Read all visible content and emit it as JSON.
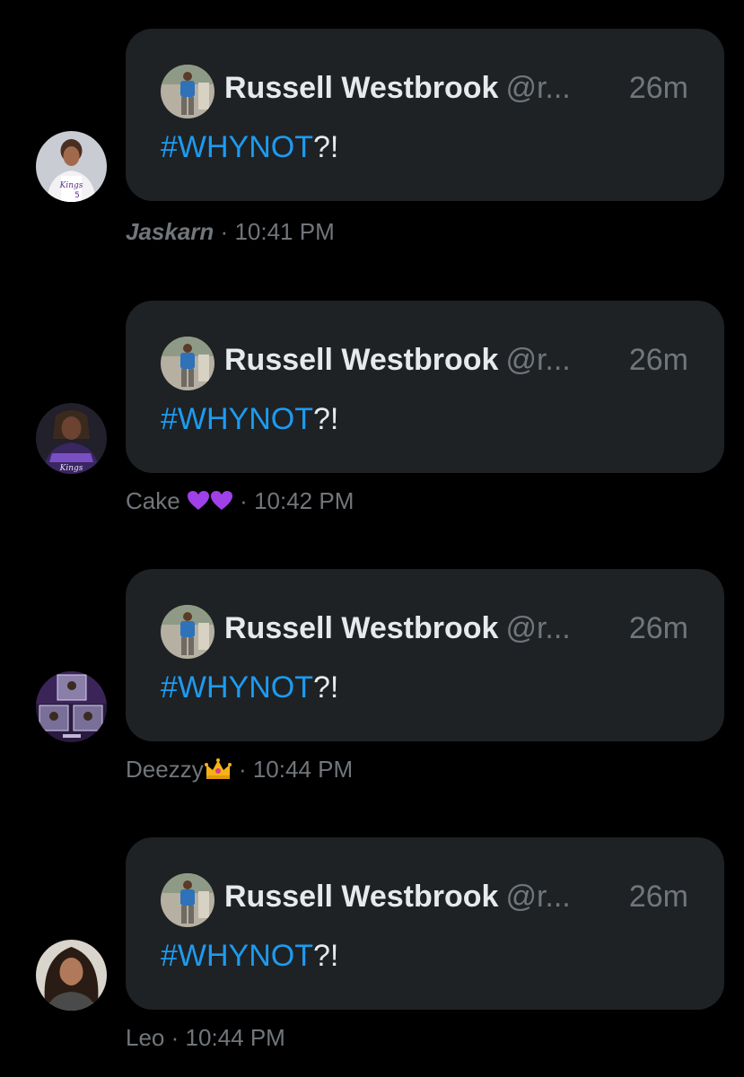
{
  "messages": [
    {
      "sender": {
        "name": "Jaskarn",
        "avatar_icon": "jersey-player-avatar-icon"
      },
      "time": "10:41 PM",
      "separator": "·",
      "quote": {
        "author_name": "Russell Westbrook",
        "author_handle": "@r...",
        "age": "26m",
        "hashtag": "#WHYNOT",
        "suffix": "?!"
      }
    },
    {
      "sender": {
        "name": "Cake",
        "name_emojis": [
          "purple-heart-icon",
          "purple-heart-icon"
        ],
        "avatar_icon": "player-avatar-icon"
      },
      "time": "10:42 PM",
      "separator": "·",
      "quote": {
        "author_name": "Russell Westbrook",
        "author_handle": "@r...",
        "age": "26m",
        "hashtag": "#WHYNOT",
        "suffix": "?!"
      }
    },
    {
      "sender": {
        "name": "Deezzy",
        "name_emojis": [
          "crown-icon"
        ],
        "avatar_icon": "card-collage-avatar-icon"
      },
      "time": "10:44 PM",
      "separator": "·",
      "quote": {
        "author_name": "Russell Westbrook",
        "author_handle": "@r...",
        "age": "26m",
        "hashtag": "#WHYNOT",
        "suffix": "?!"
      }
    },
    {
      "sender": {
        "name": "Leo",
        "avatar_icon": "curly-hair-avatar-icon"
      },
      "time": "10:44 PM",
      "separator": "·",
      "quote": {
        "author_name": "Russell Westbrook",
        "author_handle": "@r...",
        "age": "26m",
        "hashtag": "#WHYNOT",
        "suffix": "?!"
      }
    }
  ],
  "colors": {
    "background": "#000000",
    "bubble": "#1e2225",
    "primary_text": "#e7e9ea",
    "secondary_text": "#71767b",
    "hashtag": "#1d9bf0",
    "purple_heart": "#a040e8"
  }
}
